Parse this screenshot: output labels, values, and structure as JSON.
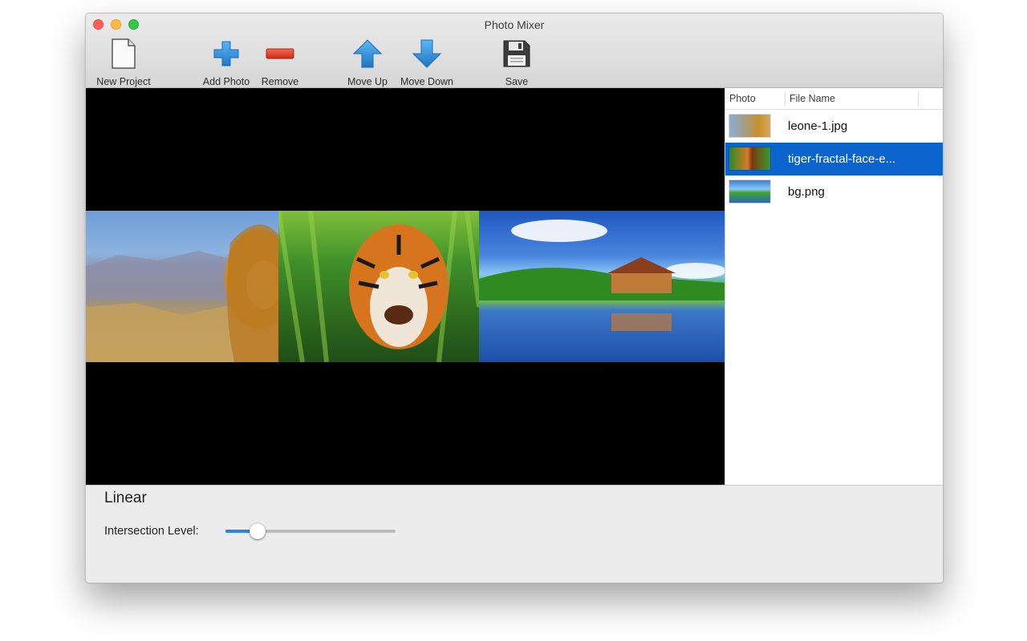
{
  "window": {
    "title": "Photo Mixer"
  },
  "toolbar": {
    "new_project": "New Project",
    "add_photo": "Add Photo",
    "remove": "Remove",
    "move_up": "Move Up",
    "move_down": "Move Down",
    "save": "Save"
  },
  "list": {
    "columns": [
      "Photo",
      "File Name"
    ],
    "rows": [
      {
        "file": "leone-1.jpg",
        "selected": false,
        "thumb": "lion-thumbnail"
      },
      {
        "file": "tiger-fractal-face-e...",
        "selected": true,
        "thumb": "tiger-thumbnail"
      },
      {
        "file": "bg.png",
        "selected": false,
        "thumb": "landscape-thumbnail"
      }
    ]
  },
  "bottom": {
    "mode": "Linear",
    "slider_label": "Intersection Level:",
    "slider_fraction": 0.19
  },
  "colors": {
    "accent": "#2a82f0",
    "selection": "#0b63ce",
    "icon_blue": "#2f8fd8",
    "icon_red": "#e0412b"
  }
}
